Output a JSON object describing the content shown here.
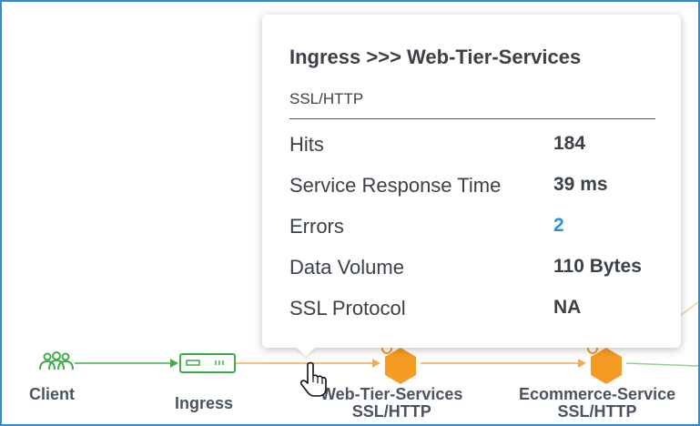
{
  "nodes": {
    "client": "Client",
    "ingress": "Ingress",
    "web_tier": {
      "name": "Web-Tier-Services",
      "protocol": "SSL/HTTP"
    },
    "ecommerce": {
      "name": "Ecommerce-Service",
      "protocol": "SSL/HTTP"
    }
  },
  "tooltip": {
    "title": "Ingress >>> Web-Tier-Services",
    "subtitle": "SSL/HTTP",
    "rows": [
      {
        "label": "Hits",
        "value": "184"
      },
      {
        "label": "Service Response Time",
        "value": "39 ms"
      },
      {
        "label": "Errors",
        "value": "2"
      },
      {
        "label": "Data Volume",
        "value": "110 Bytes"
      },
      {
        "label": "SSL Protocol",
        "value": "NA"
      }
    ]
  },
  "colors": {
    "frame_border": "#2b8fd6",
    "client_link": "#3fae49",
    "service_link": "#f5a94a",
    "service_node": "#f59b22",
    "error_value": "#2b8fd6"
  },
  "icons": {
    "client": "users-group-icon",
    "ingress": "ingress-device-icon",
    "service": "hexagon-service-icon",
    "cursor": "hand-pointer-icon"
  }
}
